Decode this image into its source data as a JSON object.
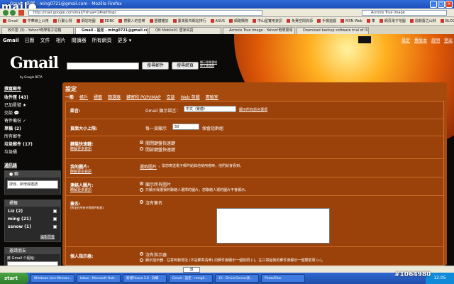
{
  "window": {
    "title": "Gmail - 設定 - ming0721@gmail.com - Mozilla Firefox"
  },
  "watermark_logo": "mail●",
  "browser": {
    "address": "http://mail.google.com/mail/?shva=1#settings",
    "search_placeholder": "Acronis True Image",
    "bookmarks": [
      "Gmail",
      "中華線上公用",
      "行動心得",
      "網站地圖",
      "EDBC",
      "感動人的音樂",
      "團體雜誌",
      "臺灣股市網站排行",
      "ASUS",
      "網路購物",
      "中山屋實用資訊",
      "免費空間資源",
      "手機遊戲",
      "MSN Web",
      "車",
      "網頁電子地圖",
      "週期置之山林",
      "BLOG 社交網"
    ],
    "tabs": [
      "收件匣 (3) - Yahoo!奇摩電子信箱",
      "Gmail - 設定 - ming0721@gmail.com",
      "QN Mobile01 居家百貨",
      "Acronis True Image - Yahoo!奇摩搜尋",
      "Download backup software trial of ISO"
    ]
  },
  "gmail": {
    "nav": [
      "Gmail",
      "日曆",
      "文件",
      "相片",
      "閱讀器",
      "所有網頁",
      "更多 ▾"
    ],
    "right_nav": [
      "設定",
      "舊版本",
      "說明",
      "登出"
    ],
    "logo_text": "Gmail",
    "logo_sub": "by Google BETA",
    "search_mail_button": "搜尋郵件",
    "search_web_button": "搜尋網頁",
    "search_options": [
      "顯示搜尋選項",
      "建立篩選器"
    ],
    "compose": "撰寫郵件",
    "folders": [
      {
        "label": "收件匣 (43)",
        "bold": true
      },
      {
        "label": "已加星號 ★",
        "bold": false
      },
      {
        "label": "交談 💬",
        "bold": false
      },
      {
        "label": "寄件備份 ✓",
        "bold": false
      },
      {
        "label": "草稿 (2)",
        "bold": true
      },
      {
        "label": "所有郵件",
        "bold": false
      },
      {
        "label": "垃圾郵件 (17)",
        "bold": true
      },
      {
        "label": "垃圾桶",
        "bold": false
      }
    ],
    "contacts": "通訊錄",
    "chat_box": {
      "title": "● 聊",
      "input": "搜尋、新增或邀請"
    },
    "labels_box": {
      "title": "標籤",
      "items": [
        "Liz (2)",
        "ming (21)",
        "ssnow (1)"
      ],
      "edit": "編輯標籤"
    },
    "invite_box": {
      "title": "邀請朋友",
      "text": "將 Gmail 介紹給："
    }
  },
  "settings": {
    "title": "設定",
    "tabs": [
      "一般",
      "帳戶",
      "標籤",
      "篩選器",
      "轉寄和 POP/IMAP",
      "交談",
      "Web 剪輯",
      "實驗室"
    ],
    "language": {
      "label": "語言:",
      "prefix": "Gmail 顯示語言：",
      "value": "中文（繁體）",
      "link": "顯示所有語言選項"
    },
    "page_size": {
      "label": "頁面大小上限:",
      "prefix": "每一頁顯示",
      "value": "50",
      "suffix": "個會話群組"
    },
    "shortcuts": {
      "label": "鍵盤快速鍵:",
      "link": "瞭解更多資訊",
      "options": [
        "關閉鍵盤快速鍵",
        "開啟鍵盤快速鍵"
      ],
      "selected": 0
    },
    "my_picture": {
      "label": "我的圖片:",
      "link": "瞭解更多資訊",
      "action": "選取圖片",
      "text": "，當您寄送電子郵件給其他使用者時，他們就會看到。"
    },
    "contact_pictures": {
      "label": "連絡人圖片:",
      "link": "瞭解更多資訊",
      "options": [
        "顯示所有圖片",
        "只顯示我選我的聯絡人選擇的圖片，您聯絡人選的圖片不會顯示。"
      ],
      "selected": 0
    },
    "signature": {
      "label": "簽名:",
      "note": "(附加在所有外寄郵件結尾)",
      "option": "沒有簽名"
    },
    "personal_indicators": {
      "label": "個人指示器:",
      "options": [
        "沒有指示器",
        "顯示指示器 - 在寄到我地址 (不是郵寄清單) 的郵件旁顯示一個箭頭 (›)，在只寄給我的郵件旁顯示一個雙箭頭 (»)。"
      ],
      "selected": 0
    }
  },
  "statusbar": {
    "find": "尋"
  },
  "taskbar": {
    "start": "start",
    "items": [
      "Windows Live Messen...",
      "Inbox - Microsoft Outl...",
      "新增Picasa 3.0 - 詳細",
      "Gmail - 設定 - ming0...",
      "15 - DriverGenius快...",
      "PhotoFilter"
    ],
    "clock": "12:05"
  },
  "watermark": "#1064980"
}
